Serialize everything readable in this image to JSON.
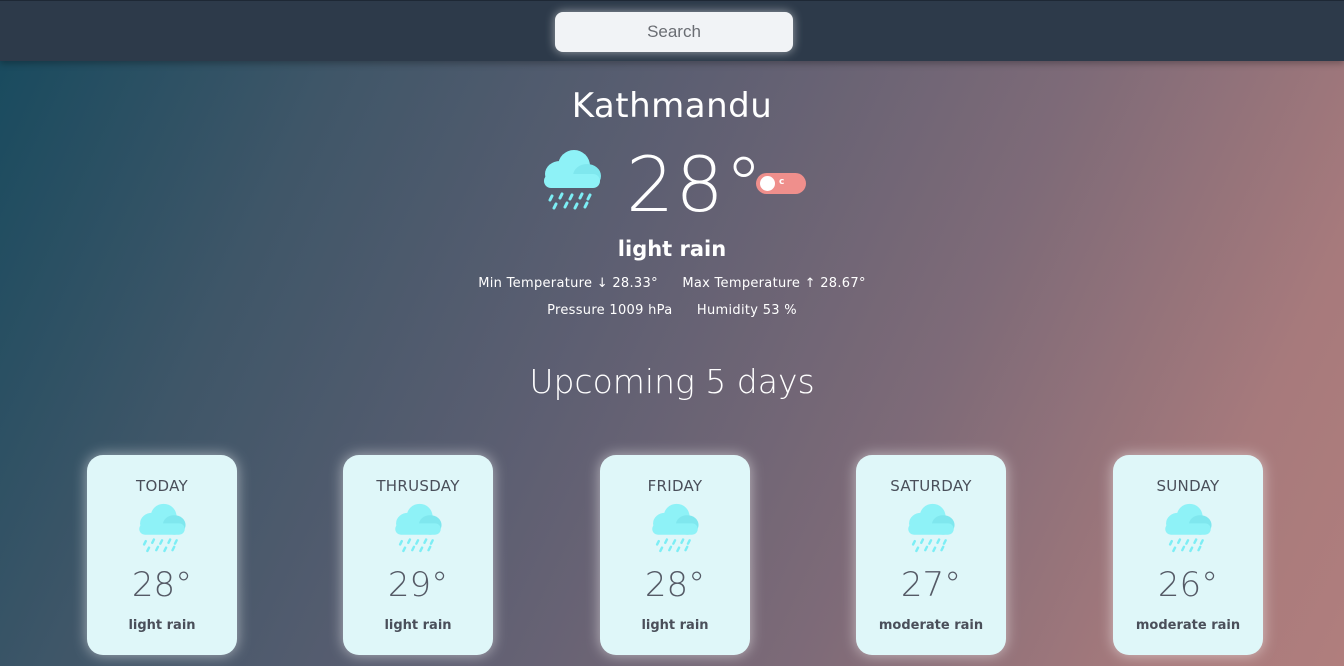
{
  "search": {
    "placeholder": "Search"
  },
  "current": {
    "city": "Kathmandu",
    "temp": "28°",
    "icon": "rain-cloud-icon",
    "unit_toggle": "c",
    "description": "light rain",
    "min_temp": "Min Temperature ↓ 28.33°",
    "max_temp": "Max Temperature ↑ 28.67°",
    "pressure": "Pressure 1009 hPa",
    "humidity": "Humidity 53 %"
  },
  "forecast_title": "Upcoming 5 days",
  "forecast": [
    {
      "day": "TODAY",
      "temp": "28°",
      "description": "light rain",
      "icon": "rain-cloud-icon"
    },
    {
      "day": "THRUSDAY",
      "temp": "29°",
      "description": "light rain",
      "icon": "rain-cloud-icon"
    },
    {
      "day": "FRIDAY",
      "temp": "28°",
      "description": "light rain",
      "icon": "rain-cloud-icon"
    },
    {
      "day": "SATURDAY",
      "temp": "27°",
      "description": "moderate rain",
      "icon": "rain-cloud-icon"
    },
    {
      "day": "SUNDAY",
      "temp": "26°",
      "description": "moderate rain",
      "icon": "rain-cloud-icon"
    }
  ],
  "colors": {
    "toggle": "#ef8f8c",
    "card_bg": "#dff7f9",
    "icon_cloud": "#7deef5",
    "topbar": "#2d3a4a"
  }
}
